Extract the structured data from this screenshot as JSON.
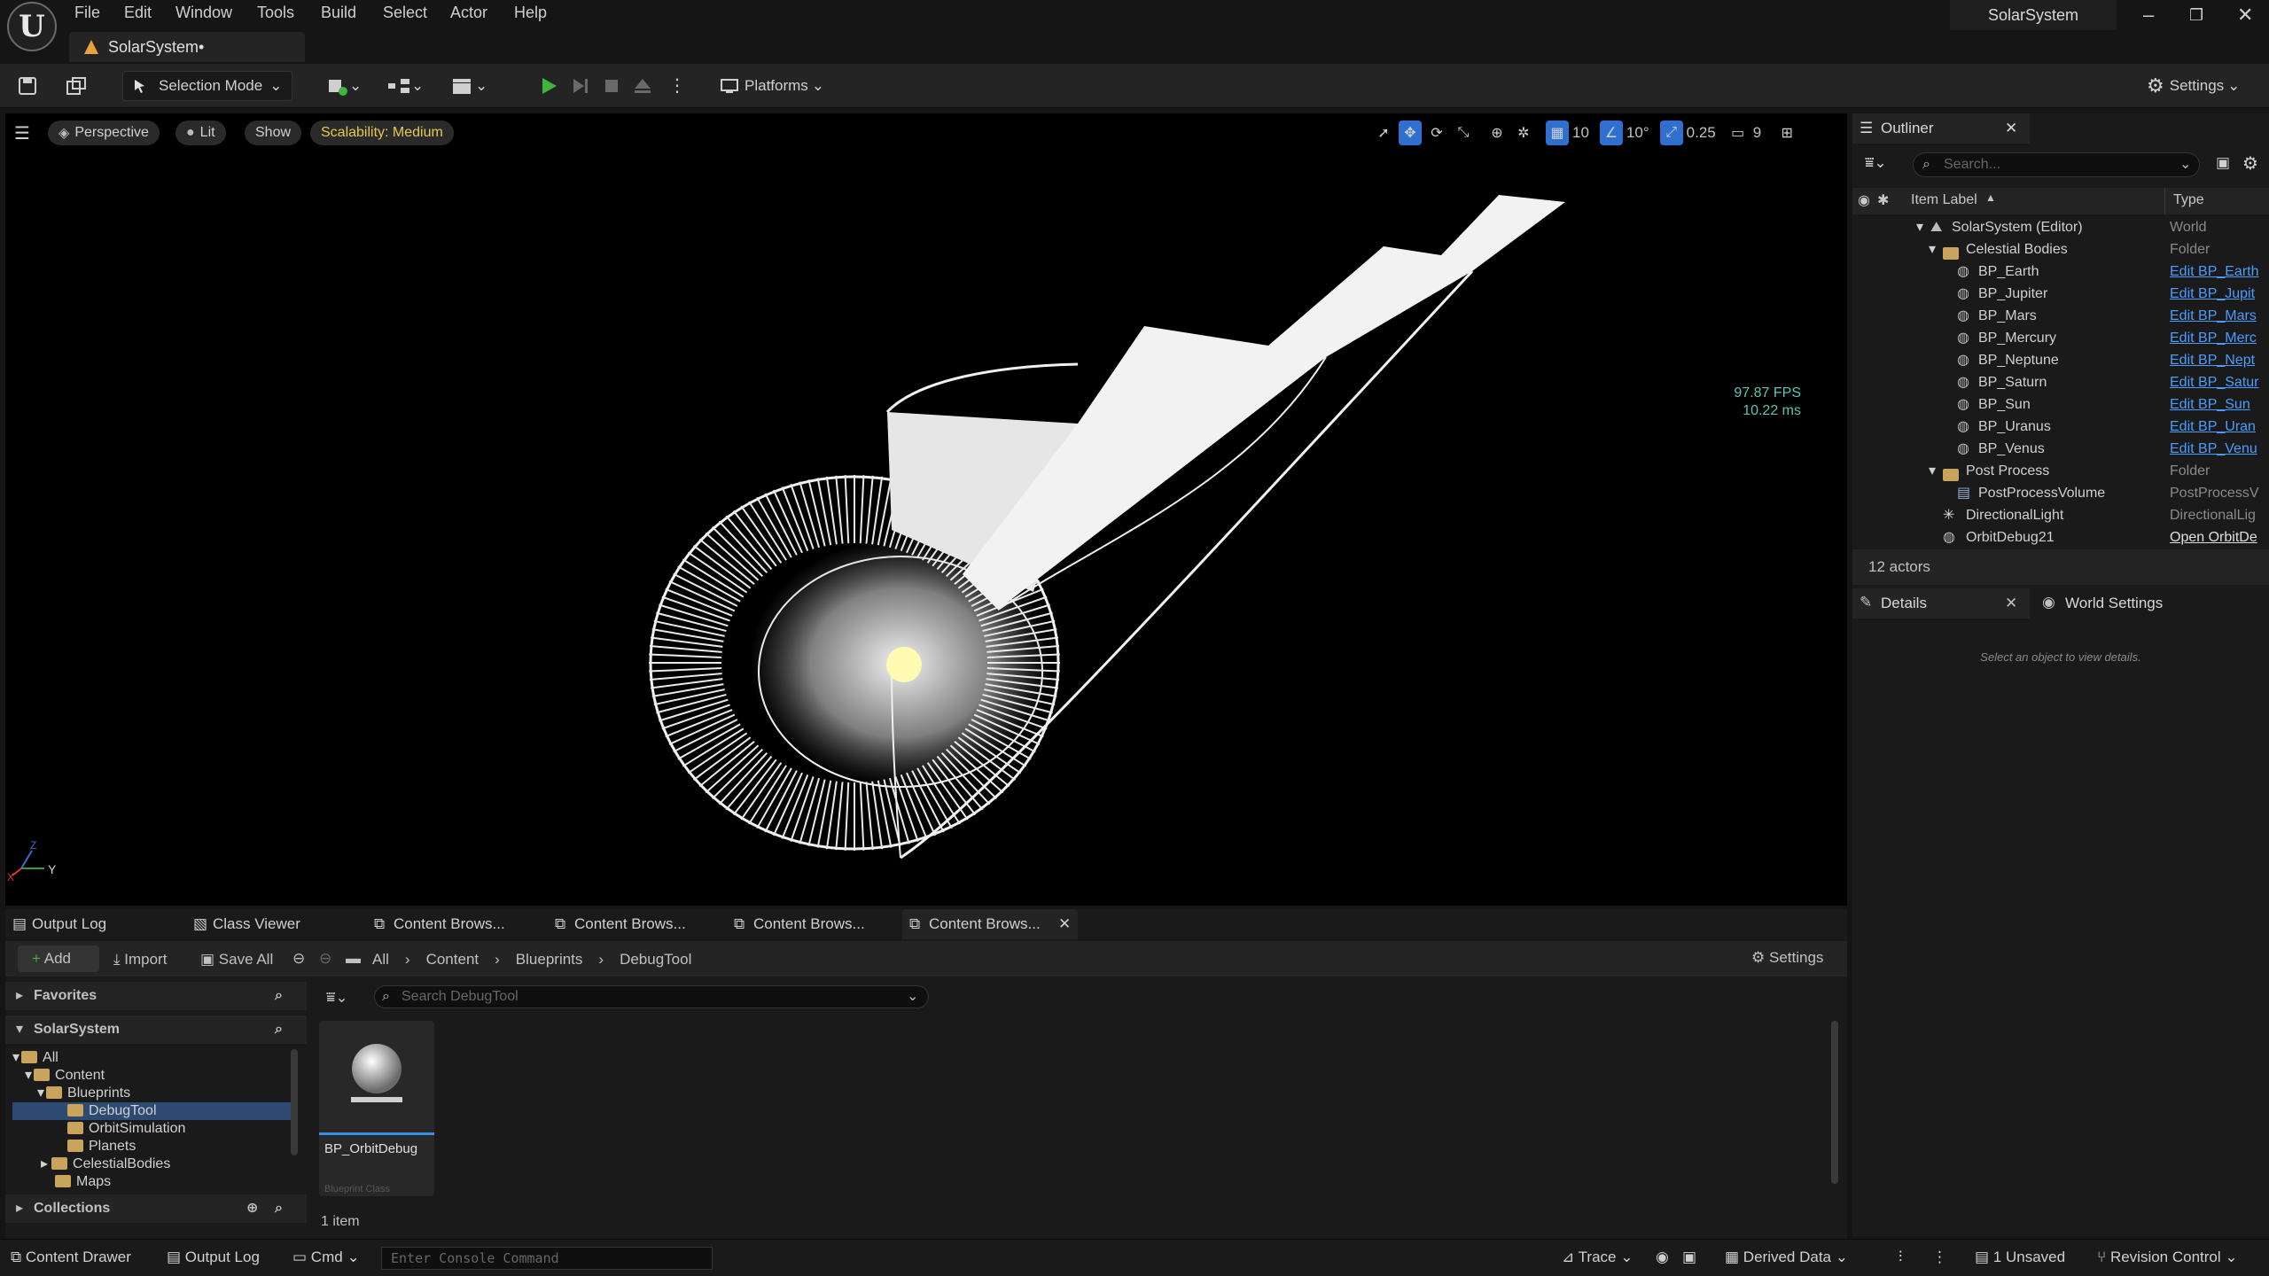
{
  "app": {
    "logo": "U",
    "doc_tab": "SolarSystem•",
    "project_name": "SolarSystem"
  },
  "menu": [
    "File",
    "Edit",
    "Window",
    "Tools",
    "Build",
    "Select",
    "Actor",
    "Help"
  ],
  "window_controls": {
    "minimize": "–",
    "restore": "❐",
    "close": "✕"
  },
  "toolbar": {
    "selection_mode": "Selection Mode",
    "platforms": "Platforms",
    "settings": "Settings"
  },
  "viewport": {
    "perspective": "Perspective",
    "lit": "Lit",
    "show": "Show",
    "scalability": "Scalability: Medium",
    "grid_snap": "10",
    "rot_snap": "10°",
    "scale_snap": "0.25",
    "cam_speed": "9",
    "fps": "97.87 FPS",
    "ms": "10.22 ms",
    "axis_z": "Z",
    "axis_y": "Y",
    "axis_x": "X"
  },
  "outliner": {
    "tab": "Outliner",
    "search_placeholder": "Search...",
    "col_label": "Item Label",
    "col_type": "Type",
    "rows": [
      {
        "label": "SolarSystem (Editor)",
        "type": "World",
        "link": false
      },
      {
        "label": "Celestial Bodies",
        "type": "Folder",
        "link": false
      },
      {
        "label": "BP_Earth",
        "type": "Edit BP_Earth",
        "link": true
      },
      {
        "label": "BP_Jupiter",
        "type": "Edit BP_Jupit",
        "link": true
      },
      {
        "label": "BP_Mars",
        "type": "Edit BP_Mars",
        "link": true
      },
      {
        "label": "BP_Mercury",
        "type": "Edit BP_Merc",
        "link": true
      },
      {
        "label": "BP_Neptune",
        "type": "Edit BP_Nept",
        "link": true
      },
      {
        "label": "BP_Saturn",
        "type": "Edit BP_Satur",
        "link": true
      },
      {
        "label": "BP_Sun",
        "type": "Edit BP_Sun",
        "link": true
      },
      {
        "label": "BP_Uranus",
        "type": "Edit BP_Uran",
        "link": true
      },
      {
        "label": "BP_Venus",
        "type": "Edit BP_Venu",
        "link": true
      },
      {
        "label": "Post Process",
        "type": "Folder",
        "link": false
      },
      {
        "label": "PostProcessVolume",
        "type": "PostProcessV",
        "link": false
      },
      {
        "label": "DirectionalLight",
        "type": "DirectionalLig",
        "link": false
      },
      {
        "label": "OrbitDebug21",
        "type": "Open OrbitDe",
        "link": true
      }
    ],
    "count": "12 actors"
  },
  "details": {
    "tab": "Details",
    "world_tab": "World Settings",
    "empty": "Select an object to view details."
  },
  "bottom_tabs": [
    "Output Log",
    "Class Viewer",
    "Content Brows...",
    "Content Brows...",
    "Content Brows...",
    "Content Brows..."
  ],
  "content_browser": {
    "add": "Add",
    "import": "Import",
    "save_all": "Save All",
    "path": [
      "All",
      "Content",
      "Blueprints",
      "DebugTool"
    ],
    "settings": "Settings",
    "favorites": "Favorites",
    "project": "SolarSystem",
    "tree": [
      {
        "label": "All",
        "level": 0
      },
      {
        "label": "Content",
        "level": 1
      },
      {
        "label": "Blueprints",
        "level": 2
      },
      {
        "label": "DebugTool",
        "level": 3
      },
      {
        "label": "OrbitSimulation",
        "level": 3
      },
      {
        "label": "Planets",
        "level": 3
      },
      {
        "label": "CelestialBodies",
        "level": 2
      },
      {
        "label": "Maps",
        "level": 2
      }
    ],
    "collections": "Collections",
    "search_placeholder": "Search DebugTool",
    "asset_name": "BP_OrbitDebug",
    "asset_type": "Blueprint Class",
    "item_count": "1 item"
  },
  "statusbar": {
    "content_drawer": "Content Drawer",
    "output_log": "Output Log",
    "cmd": "Cmd",
    "console_placeholder": "Enter Console Command",
    "trace": "Trace",
    "derived_data": "Derived Data",
    "unsaved": "1 Unsaved",
    "revision": "Revision Control"
  },
  "colors": {
    "accent_blue": "#2f6fd0",
    "play_green": "#3fb53f",
    "scalability_yellow": "#e8c84a",
    "link_blue": "#4a9cff",
    "fps_teal": "#5fc3b5"
  }
}
